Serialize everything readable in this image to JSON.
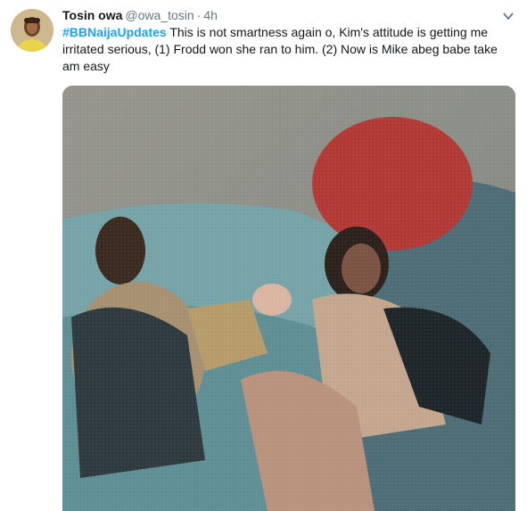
{
  "tweet": {
    "author_name": "Tosin owa",
    "handle": "@owa_tosin",
    "separator": "·",
    "time": "4h",
    "hashtag": "#BBNaijaUpdates",
    "text": " This is not smartness again o, Kim's attitude is getting me irritated serious, (1) Frodd won she ran to him. (2) Now is Mike abeg babe take am easy",
    "caret_icon": "chevron-down-icon",
    "avatar_icon": "avatar",
    "media_icon": "photo"
  },
  "colors": {
    "hashtag": "#1da1f2",
    "secondary_text": "#657786",
    "primary_text": "#14171a"
  }
}
